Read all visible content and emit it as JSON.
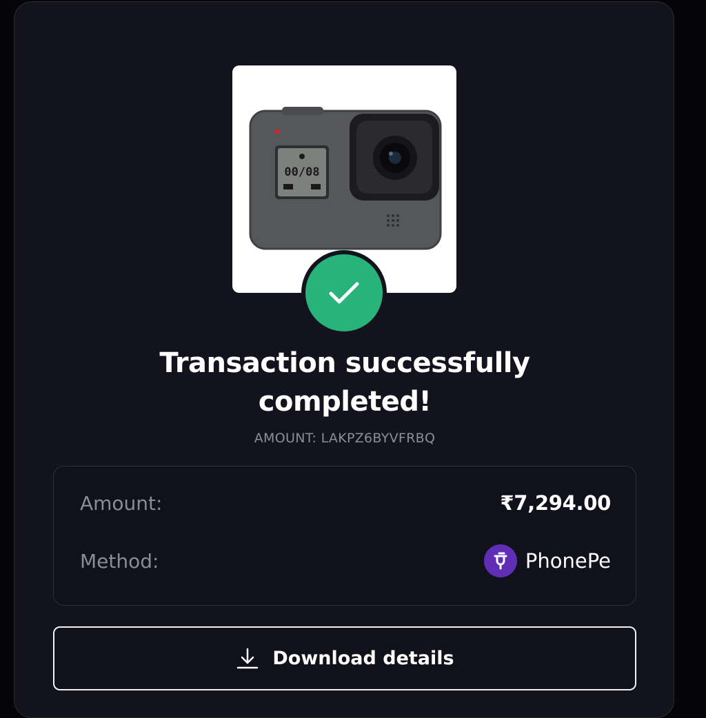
{
  "product": {
    "image_icon": "action-camera-image",
    "camera_screen_text": "00/08"
  },
  "status": {
    "icon": "checkmark-icon",
    "color": "#27b37a",
    "title_line1": "Transaction successfully",
    "title_line2": "completed!"
  },
  "reference": "AMOUNT: LAKPZ6BYVFRBQ",
  "details": {
    "amount_label": "Amount:",
    "amount_value": "₹7,294.00",
    "method_label": "Method:",
    "method_value": "PhonePe",
    "method_icon": "phonepe-logo",
    "method_color": "#5f2eb4"
  },
  "download": {
    "label": "Download details",
    "icon": "download-icon"
  }
}
